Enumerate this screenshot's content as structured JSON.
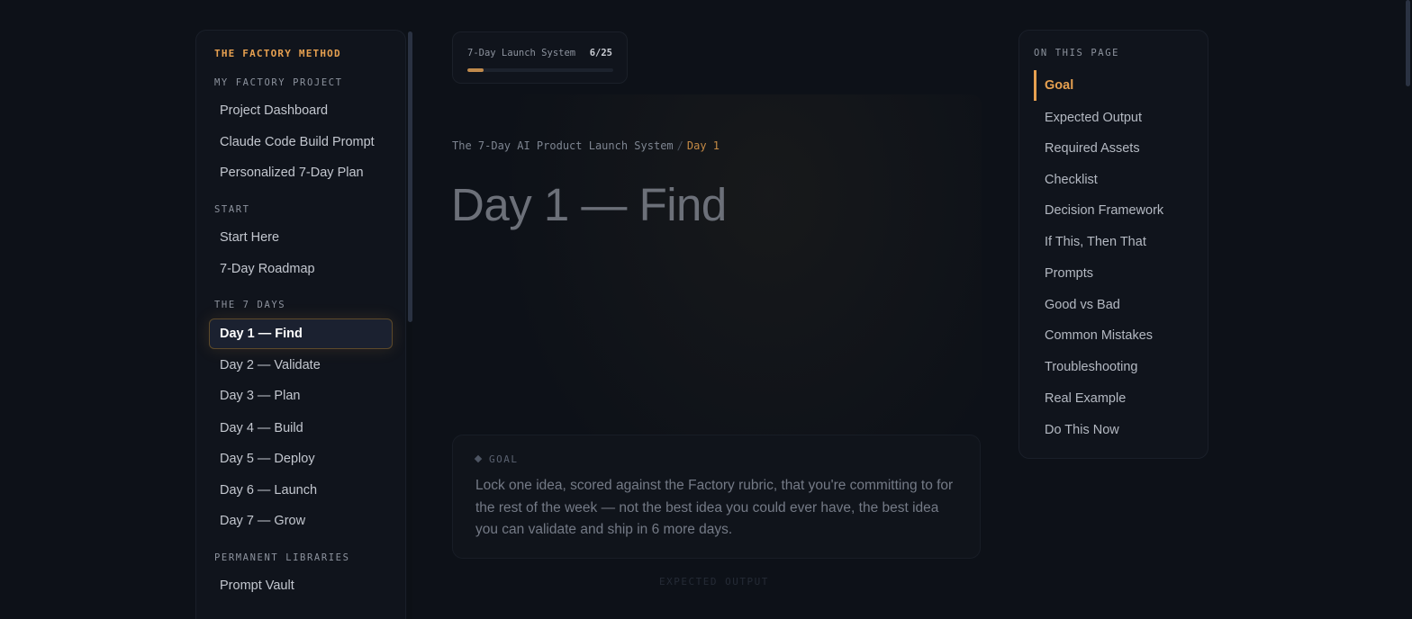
{
  "sidebar": {
    "brand": "THE FACTORY METHOD",
    "sections": [
      {
        "title": "MY FACTORY PROJECT",
        "items": [
          "Project Dashboard",
          "Claude Code Build Prompt",
          "Personalized 7-Day Plan"
        ]
      },
      {
        "title": "START",
        "items": [
          "Start Here",
          "7-Day Roadmap"
        ]
      },
      {
        "title": "THE 7 DAYS",
        "items": [
          "Day 1 — Find",
          "Day 2 — Validate",
          "Day 3 — Plan",
          "Day 4 — Build",
          "Day 5 — Deploy",
          "Day 6 — Launch",
          "Day 7 — Grow"
        ]
      },
      {
        "title": "PERMANENT LIBRARIES",
        "items": [
          "Prompt Vault"
        ]
      }
    ],
    "active_item": "Day 1 — Find"
  },
  "progress": {
    "label": "7-Day Launch System",
    "count": "6/25",
    "fraction": 0.11
  },
  "breadcrumb": {
    "parent": "The 7-Day AI Product Launch System",
    "separator": "/",
    "current": "Day 1"
  },
  "page_title": "Day 1 — Find",
  "goal": {
    "heading": "GOAL",
    "text": "Lock one idea, scored against the Factory rubric, that you're committing to for the rest of the week — not the best idea you could ever have, the best idea you can validate and ship in 6 more days."
  },
  "next_section_heading": "EXPECTED OUTPUT",
  "toc": {
    "heading": "ON THIS PAGE",
    "items": [
      "Goal",
      "Expected Output",
      "Required Assets",
      "Checklist",
      "Decision Framework",
      "If This, Then That",
      "Prompts",
      "Good vs Bad",
      "Common Mistakes",
      "Troubleshooting",
      "Real Example",
      "Do This Now"
    ],
    "active": "Goal"
  },
  "colors": {
    "accent": "#e6a050",
    "background": "#0d1118",
    "panel": "#10141c"
  }
}
